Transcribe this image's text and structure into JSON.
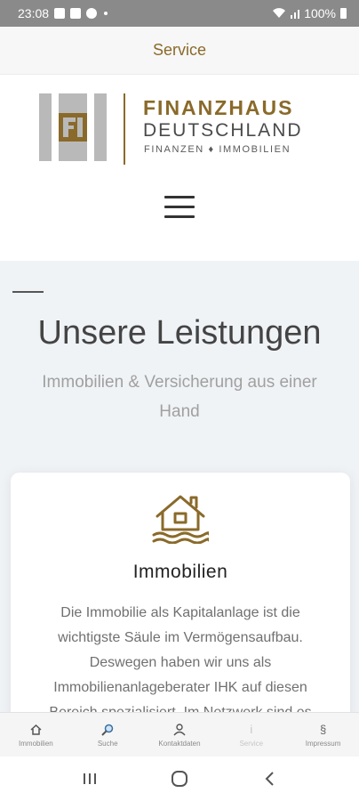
{
  "status_bar": {
    "time": "23:08",
    "battery": "100%"
  },
  "titlebar": {
    "title": "Service"
  },
  "logo": {
    "line1": "FINANZHAUS",
    "line2": "DEUTSCHLAND",
    "line3": "FINANZEN ♦ IMMOBILIEN"
  },
  "section": {
    "title": "Unsere Leistungen",
    "subtitle": "Immobilien & Versicherung aus einer Hand"
  },
  "card": {
    "icon": "house-water-icon",
    "title": "Immobilien",
    "text": "Die Immobilie als Kapitalanlage ist die wichtigste Säule im Vermögensaufbau. Deswegen haben wir uns als Immobilienanlageberater IHK auf diesen Bereich spezialisiert. Im Netzwerk sind es"
  },
  "tabs": [
    {
      "label": "Immobilien",
      "icon": "home-icon",
      "active": true
    },
    {
      "label": "Suche",
      "icon": "search-icon",
      "active": true
    },
    {
      "label": "Kontaktdaten",
      "icon": "contact-icon",
      "active": true
    },
    {
      "label": "Service",
      "icon": "info-icon",
      "active": false
    },
    {
      "label": "Impressum",
      "icon": "paragraph-icon",
      "active": true
    }
  ],
  "colors": {
    "brand_gold": "#8a6a2a",
    "section_bg": "#f0f3f6"
  }
}
